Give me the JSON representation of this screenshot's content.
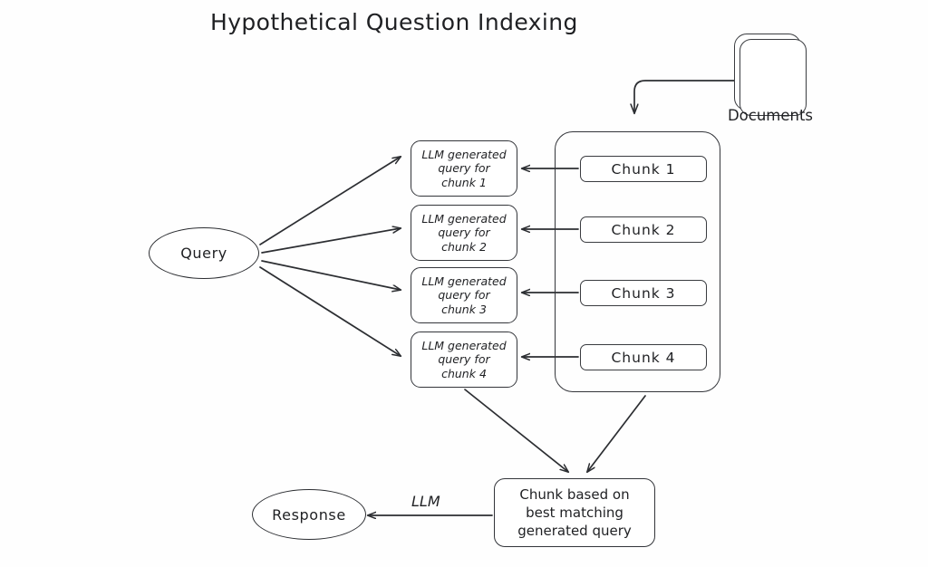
{
  "diagram": {
    "title": "Hypothetical Question Indexing",
    "background_color": "#fefefe",
    "stroke_color": "#33353a",
    "text_color": "#1f2023"
  },
  "nodes": {
    "query": {
      "label": "Query"
    },
    "response": {
      "label": "Response"
    },
    "documents": {
      "label": "Documents"
    },
    "final_chunk": {
      "line1": "Chunk based on",
      "line2": "best matching",
      "line3": "generated query"
    }
  },
  "generated_queries": [
    {
      "line1": "LLM generated",
      "line2": "query for",
      "line3": "chunk 1"
    },
    {
      "line1": "LLM generated",
      "line2": "query for",
      "line3": "chunk 2"
    },
    {
      "line1": "LLM generated",
      "line2": "query for",
      "line3": "chunk 3"
    },
    {
      "line1": "LLM generated",
      "line2": "query for",
      "line3": "chunk 4"
    }
  ],
  "chunks": [
    {
      "label": "Chunk 1"
    },
    {
      "label": "Chunk 2"
    },
    {
      "label": "Chunk 3"
    },
    {
      "label": "Chunk 4"
    }
  ],
  "edge_labels": {
    "llm": "LLM"
  }
}
